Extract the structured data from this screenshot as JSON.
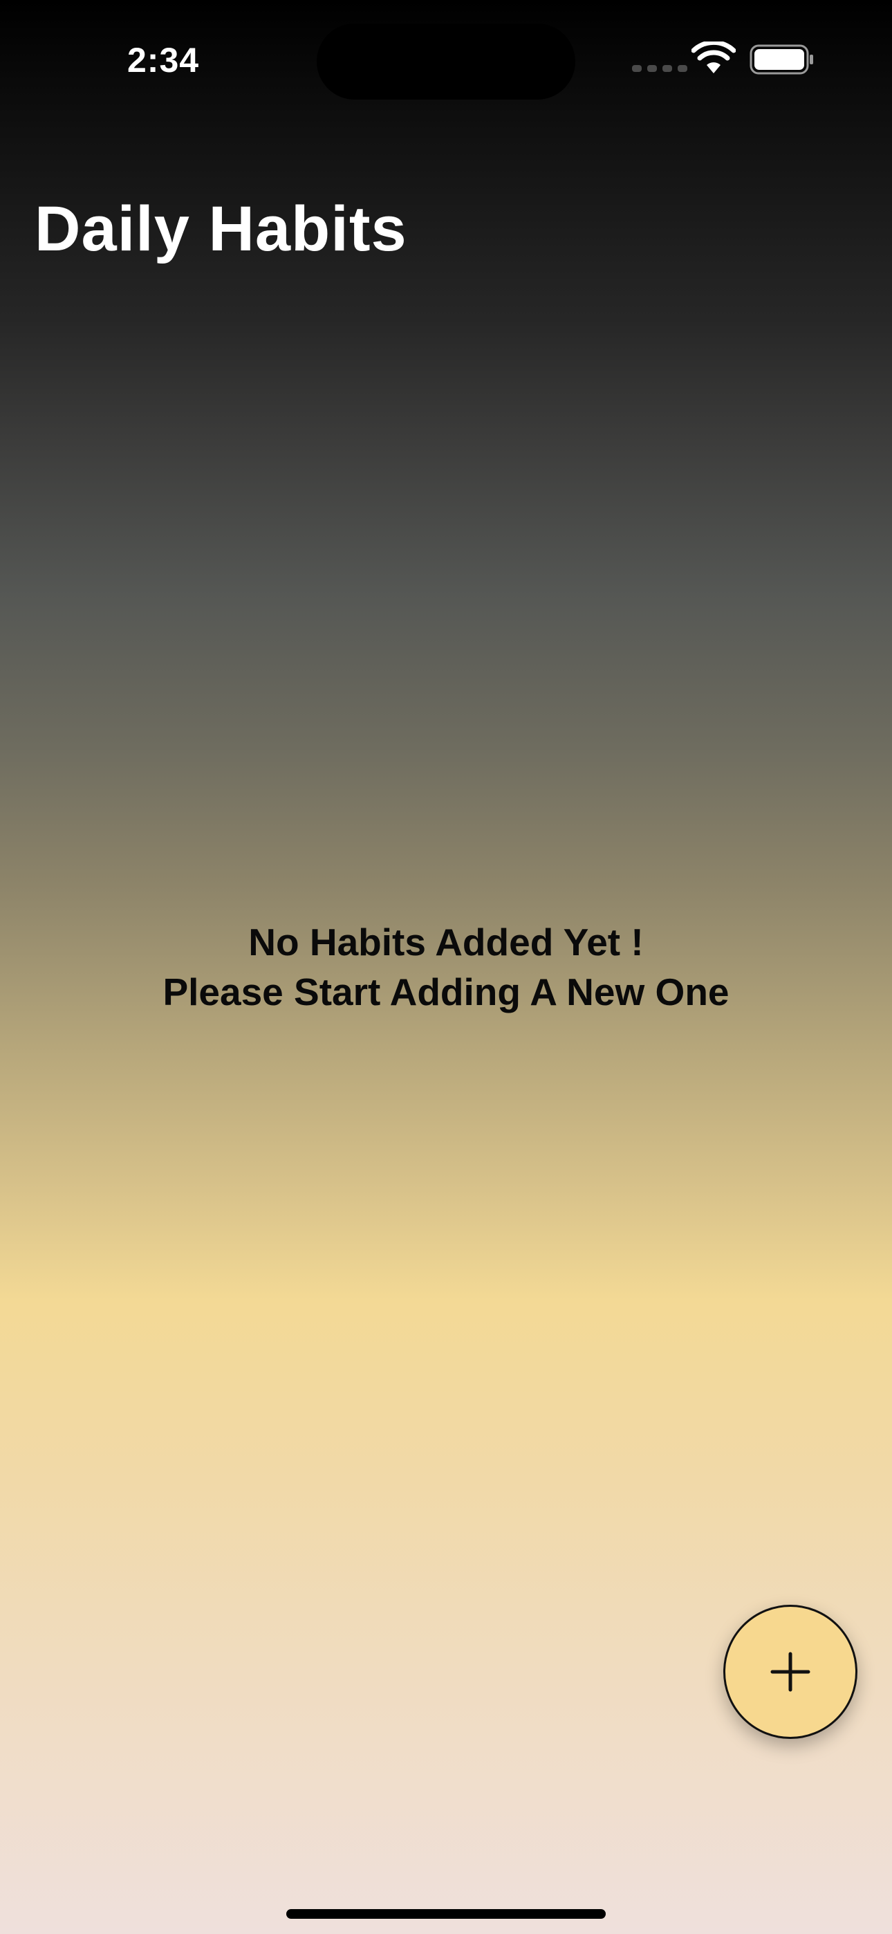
{
  "status_bar": {
    "time": "2:34",
    "signal_icon": "cellular-signal-icon",
    "wifi_icon": "wifi-icon",
    "battery_icon": "battery-icon"
  },
  "header": {
    "title": "Daily Habits"
  },
  "empty_state": {
    "line1": "No Habits Added Yet !",
    "line2": "Please Start Adding A New One"
  },
  "fab": {
    "icon": "plus-icon",
    "color": "#f7d88f"
  },
  "colors": {
    "background_top": "#000000",
    "background_mid": "#f3d995",
    "background_bottom": "#efe0dc"
  }
}
